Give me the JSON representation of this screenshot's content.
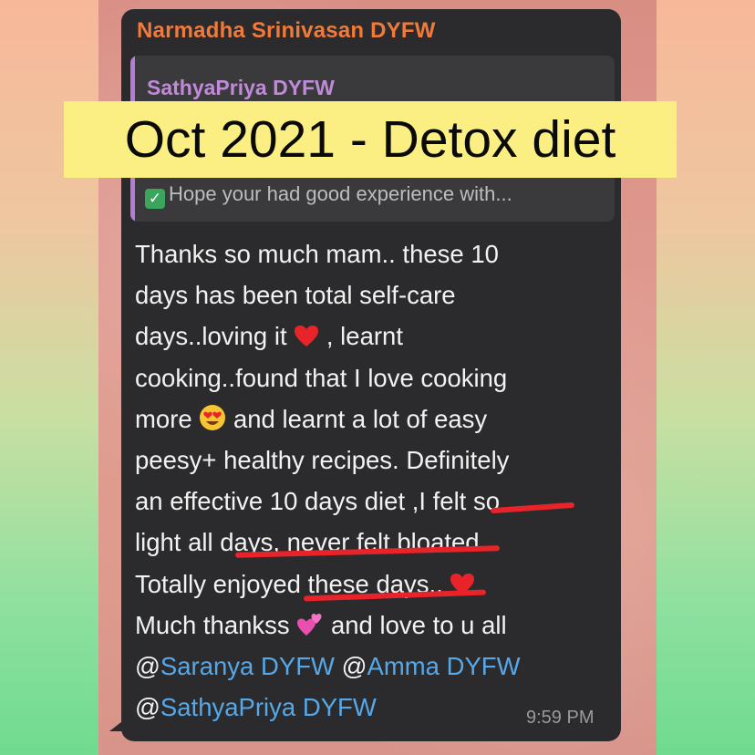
{
  "banner": {
    "title": "Oct 2021 - Detox diet"
  },
  "message": {
    "sender": "Narmadha Srinivasan DYFW",
    "quote": {
      "author": "SathyaPriya DYFW",
      "text": "Hope your had good experience with..."
    },
    "lines": [
      "Thanks so much mam.. these 10",
      "days has been total self-care",
      "days..loving it",
      ", learnt",
      "cooking..found that I love cooking",
      "more",
      "and learnt a lot of easy",
      "peesy+ healthy recipes. Definitely",
      "an effective 10 days diet ,I felt so",
      "light all days, never felt bloated ..",
      "Totally enjoyed these days..",
      "Much thankss",
      "and love to u all"
    ],
    "mentions": [
      "@",
      "Saranya DYFW",
      "@",
      "Amma DYFW",
      "@",
      "SathyaPriya DYFW"
    ],
    "time": "9:59 PM"
  },
  "icons": {
    "quote_check": "check-mark-icon",
    "heart": "red-heart-icon",
    "heart_eyes": "heart-eyes-emoji-icon",
    "two_hearts": "two-hearts-icon"
  }
}
